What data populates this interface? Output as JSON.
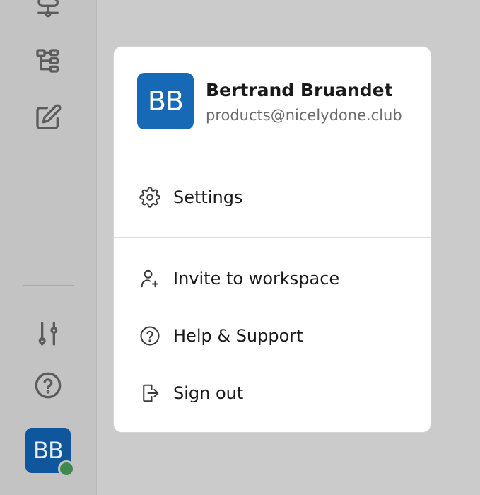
{
  "user": {
    "initials": "BB",
    "name": "Bertrand Bruandet",
    "email": "products@nicelydone.club"
  },
  "menu": {
    "settings": {
      "label": "Settings",
      "icon": "gear-icon"
    },
    "invite": {
      "label": "Invite to workspace",
      "icon": "user-plus-icon"
    },
    "help": {
      "label": "Help & Support",
      "icon": "help-circle-icon"
    },
    "signout": {
      "label": "Sign out",
      "icon": "log-out-icon"
    }
  },
  "sidebar": {
    "icons": [
      "cloud-network-icon",
      "tree-structure-icon",
      "edit-icon",
      "sliders-icon",
      "help-circle-icon"
    ]
  },
  "colors": {
    "avatar_bg": "#1768b5",
    "status_online": "#3f8a4f"
  }
}
